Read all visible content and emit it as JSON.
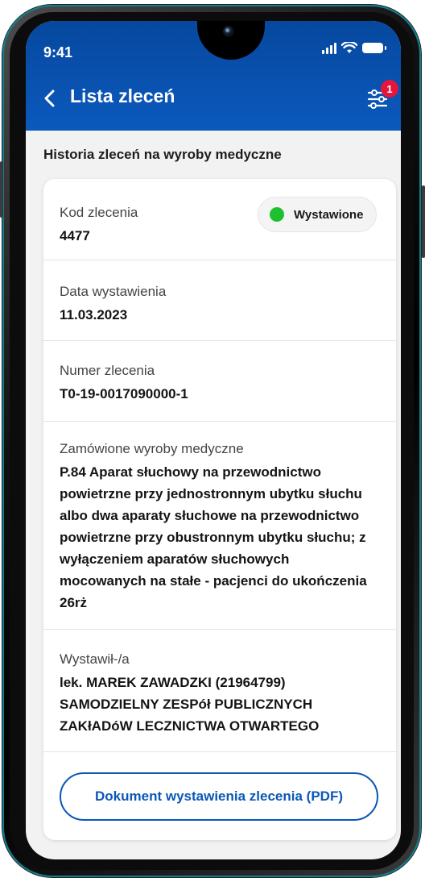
{
  "status_bar": {
    "time": "9:41"
  },
  "nav": {
    "title": "Lista zleceń",
    "filter_badge": "1"
  },
  "section_title": "Historia zleceń na wyroby medyczne",
  "order": {
    "code_label": "Kod zlecenia",
    "code_value": "4477",
    "status": "Wystawione",
    "status_color": "#1ec02f",
    "date_label": "Data wystawienia",
    "date_value": "11.03.2023",
    "number_label": "Numer zlecenia",
    "number_value": "T0-19-0017090000-1",
    "items_label": "Zamówione wyroby medyczne",
    "items_lines": [
      "P.84 Aparat słuchowy na przewodnictwo",
      "powietrzne przy jednostronnym ubytku słuchu",
      "albo dwa aparaty słuchowe na przewodnictwo",
      "powietrzne przy obustronnym ubytku słuchu; z",
      "wyłączeniem aparatów słuchowych",
      "mocowanych na stałe - pacjenci do ukończenia",
      "26rż"
    ],
    "issuer_label": "Wystawił-/a",
    "issuer_lines": [
      "lek. MAREK ZAWADZKI (21964799)",
      "SAMODZIELNY ZESPół PUBLICZNYCH",
      "ZAKłADóW LECZNICTWA OTWARTEGO"
    ]
  },
  "pdf_button_label": "Dokument wystawienia zlecenia (PDF)",
  "colors": {
    "header": "#0b59bd",
    "accent": "#0b57b7",
    "badge": "#e5153b"
  }
}
